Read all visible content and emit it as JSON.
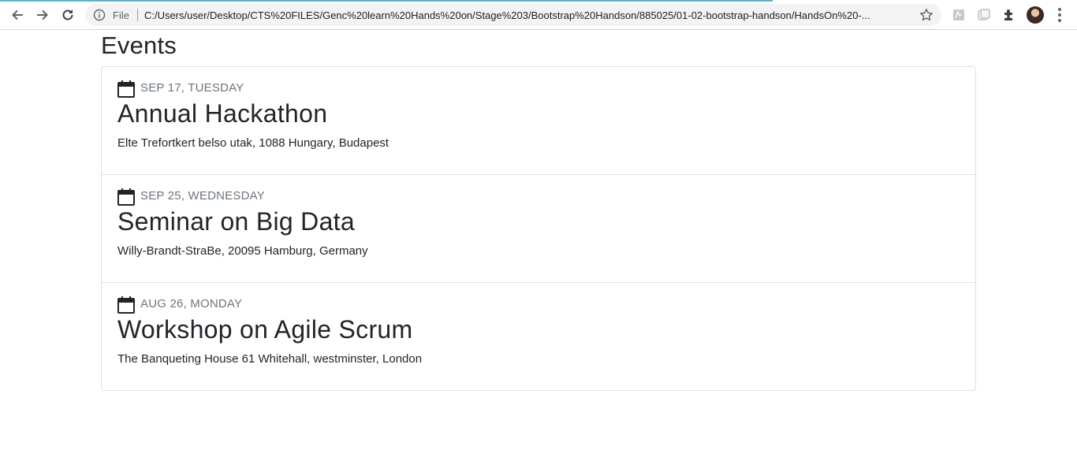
{
  "browser": {
    "scheme_label": "File",
    "url": "C:/Users/user/Desktop/CTS%20FILES/Genc%20learn%20Hands%20on/Stage%203/Bootstrap%20Handson/885025/01-02-bootstrap-handson/HandsOn%20-..."
  },
  "page": {
    "title": "Events"
  },
  "events": [
    {
      "date": "SEP 17, TUESDAY",
      "title": "Annual Hackathon",
      "address": "Elte Trefortkert belso utak, 1088 Hungary, Budapest"
    },
    {
      "date": "SEP 25, WEDNESDAY",
      "title": "Seminar on Big Data",
      "address": "Willy-Brandt-StraBe, 20095 Hamburg, Germany"
    },
    {
      "date": "AUG 26, MONDAY",
      "title": "Workshop on Agile Scrum",
      "address": "The Banqueting House 61 Whitehall, westminster, London"
    }
  ]
}
